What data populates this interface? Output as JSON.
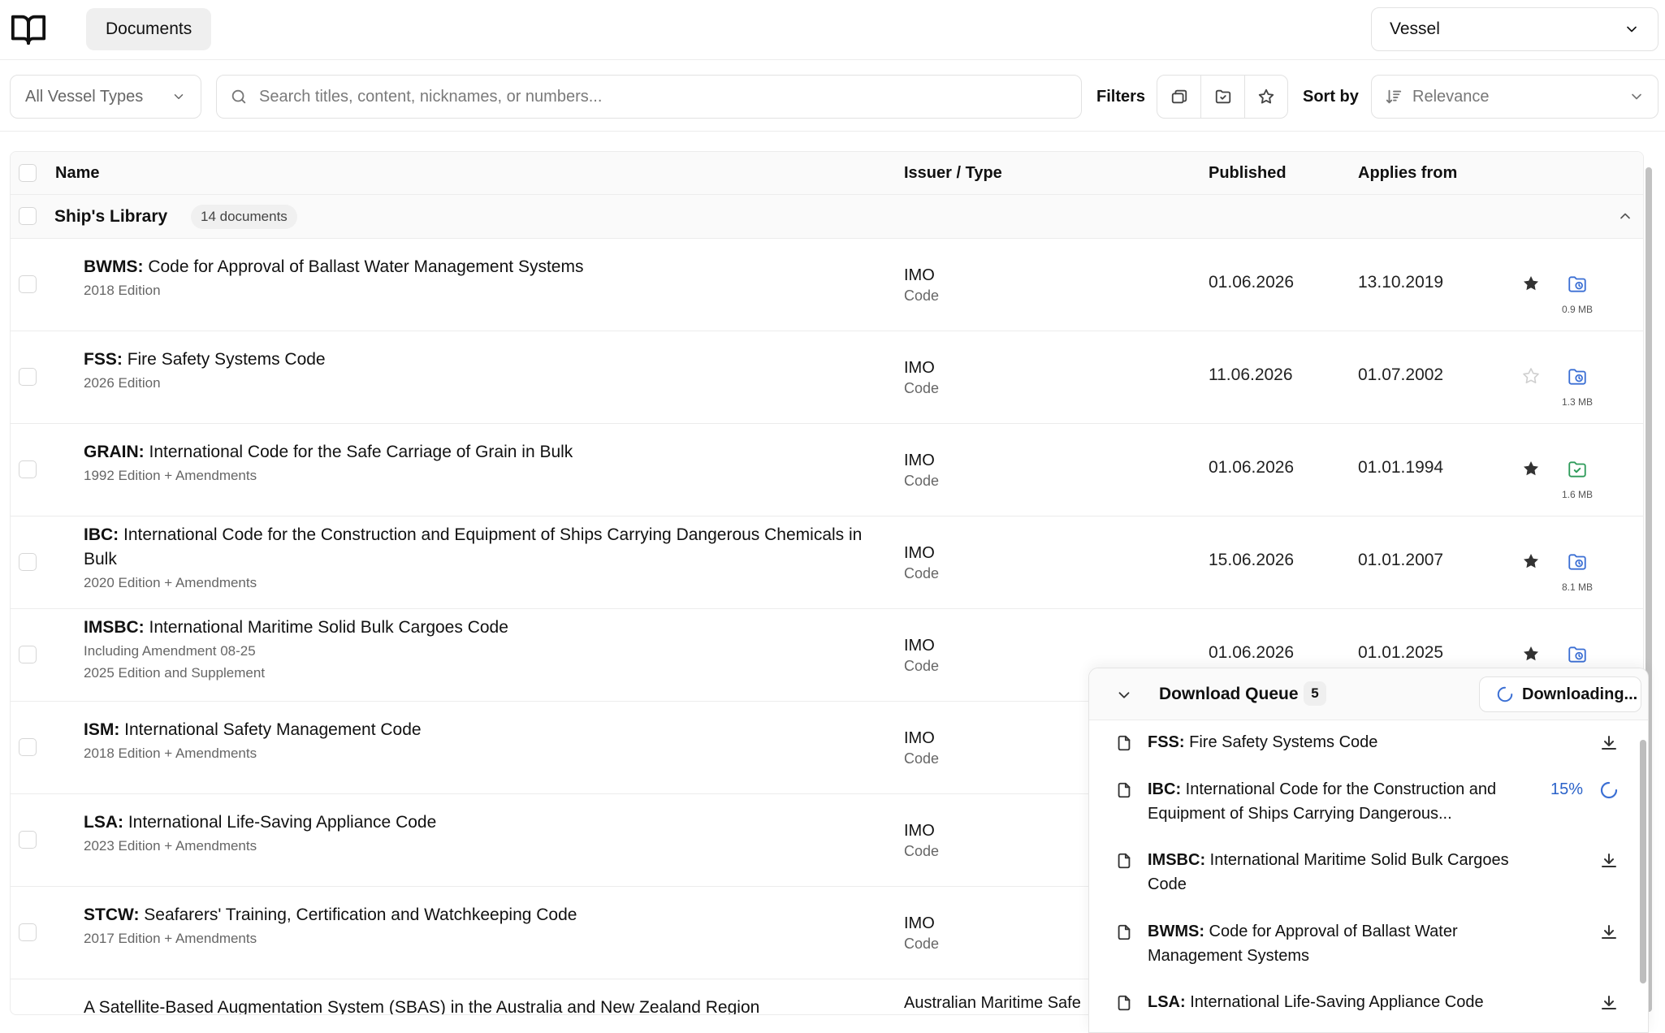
{
  "header": {
    "tab_label": "Documents",
    "vessel_select": "Vessel"
  },
  "filterbar": {
    "vessel_types": "All Vessel Types",
    "search_placeholder": "Search titles, content, nicknames, or numbers...",
    "filters_label": "Filters",
    "sort_label": "Sort by",
    "sort_value": "Relevance"
  },
  "table": {
    "columns": {
      "name": "Name",
      "issuer": "Issuer / Type",
      "published": "Published",
      "applies": "Applies from"
    },
    "group": {
      "name": "Ship's Library",
      "count": "14 documents"
    },
    "rows": [
      {
        "code": "BWMS:",
        "title": "Code for Approval of Ballast Water Management Systems",
        "sub1": "2018 Edition",
        "sub2": "",
        "issuer": "IMO",
        "type": "Code",
        "published": "01.06.2026",
        "applies": "13.10.2019",
        "starred": true,
        "size": "0.9 MB",
        "status": "scheduled"
      },
      {
        "code": "FSS:",
        "title": "Fire Safety Systems Code",
        "sub1": "2026 Edition",
        "sub2": "",
        "issuer": "IMO",
        "type": "Code",
        "published": "11.06.2026",
        "applies": "01.07.2002",
        "starred": false,
        "size": "1.3 MB",
        "status": "scheduled"
      },
      {
        "code": "GRAIN:",
        "title": "International Code for the Safe Carriage of Grain in Bulk",
        "sub1": "1992 Edition + Amendments",
        "sub2": "",
        "issuer": "IMO",
        "type": "Code",
        "published": "01.06.2026",
        "applies": "01.01.1994",
        "starred": true,
        "size": "1.6 MB",
        "status": "downloaded"
      },
      {
        "code": "IBC:",
        "title": "International Code for the Construction and Equipment of Ships Carrying Dangerous Chemicals in Bulk",
        "sub1": "2020 Edition + Amendments",
        "sub2": "",
        "issuer": "IMO",
        "type": "Code",
        "published": "15.06.2026",
        "applies": "01.01.2007",
        "starred": true,
        "size": "8.1 MB",
        "status": "scheduled"
      },
      {
        "code": "IMSBC:",
        "title": "International Maritime Solid Bulk Cargoes Code",
        "sub1": "Including Amendment 08-25",
        "sub2": "2025 Edition and Supplement",
        "issuer": "IMO",
        "type": "Code",
        "published": "01.06.2026",
        "applies": "01.01.2025",
        "starred": true,
        "size": "",
        "status": "scheduled"
      },
      {
        "code": "ISM:",
        "title": "International Safety Management Code",
        "sub1": "2018 Edition + Amendments",
        "sub2": "",
        "issuer": "IMO",
        "type": "Code",
        "published": "",
        "applies": "",
        "starred": false,
        "size": "",
        "status": ""
      },
      {
        "code": "LSA:",
        "title": "International Life-Saving Appliance Code",
        "sub1": "2023 Edition + Amendments",
        "sub2": "",
        "issuer": "IMO",
        "type": "Code",
        "published": "",
        "applies": "",
        "starred": false,
        "size": "",
        "status": ""
      },
      {
        "code": "STCW:",
        "title": "Seafarers' Training, Certification and Watchkeeping Code",
        "sub1": "2017 Edition + Amendments",
        "sub2": "",
        "issuer": "IMO",
        "type": "Code",
        "published": "",
        "applies": "",
        "starred": false,
        "size": "",
        "status": ""
      },
      {
        "code": "",
        "title": "A Satellite-Based Augmentation System (SBAS) in the Australia and New Zealand Region",
        "sub1": "",
        "sub2": "",
        "issuer": "Australian Maritime Safe",
        "type": "",
        "published": "",
        "applies": "",
        "starred": false,
        "size": "",
        "status": ""
      }
    ]
  },
  "download_queue": {
    "title": "Download Queue",
    "count": "5",
    "status": "Downloading...",
    "items": [
      {
        "code": "FSS:",
        "title": "Fire Safety Systems Code",
        "action": "download",
        "progress": ""
      },
      {
        "code": "IBC:",
        "title": "International Code for the Construction and Equipment of Ships Carrying Dangerous...",
        "action": "loading",
        "progress": "15%"
      },
      {
        "code": "IMSBC:",
        "title": "International Maritime Solid Bulk Cargoes Code",
        "action": "download",
        "progress": ""
      },
      {
        "code": "BWMS:",
        "title": "Code for Approval of Ballast Water Management Systems",
        "action": "download",
        "progress": ""
      },
      {
        "code": "LSA:",
        "title": "International Life-Saving Appliance Code",
        "action": "download",
        "progress": ""
      }
    ]
  },
  "colors": {
    "accent_blue": "#3b6fd4",
    "downloaded_green": "#2e9b5a",
    "progress_blue": "#2a62c9"
  }
}
